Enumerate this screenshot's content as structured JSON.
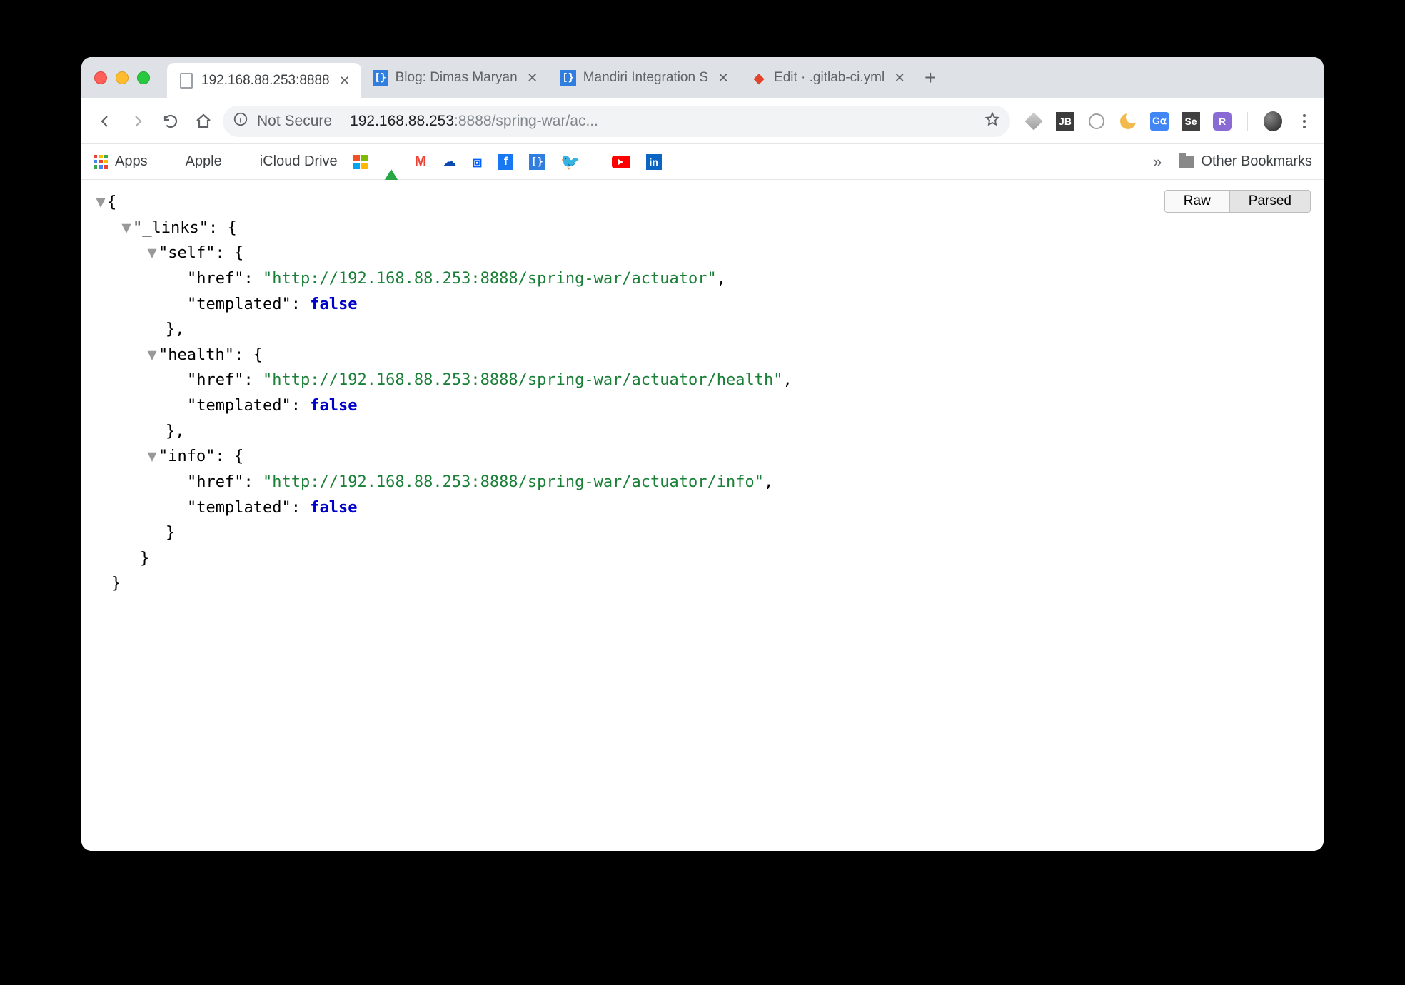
{
  "tabs": [
    {
      "title": "192.168.88.253:8888",
      "active": true,
      "icon": "file"
    },
    {
      "title": "Blog: Dimas Maryan",
      "active": false,
      "icon": "braces"
    },
    {
      "title": "Mandiri Integration S",
      "active": false,
      "icon": "braces"
    },
    {
      "title": "Edit · .gitlab-ci.yml",
      "active": false,
      "icon": "gitlab"
    }
  ],
  "address": {
    "security_label": "Not Secure",
    "host": "192.168.88.253",
    "port_path": ":8888/spring-war/ac..."
  },
  "bookmarks": {
    "apps": "Apps",
    "apple": "Apple",
    "icloud": "iCloud Drive",
    "other": "Other Bookmarks"
  },
  "json_buttons": {
    "raw": "Raw",
    "parsed": "Parsed"
  },
  "json": {
    "links_key": "_links",
    "self": {
      "key": "self",
      "href_key": "href",
      "href_val": "http://192.168.88.253:8888/spring-war/actuator",
      "templated_key": "templated",
      "templated_val": "false"
    },
    "health": {
      "key": "health",
      "href_key": "href",
      "href_val": "http://192.168.88.253:8888/spring-war/actuator/health",
      "templated_key": "templated",
      "templated_val": "false"
    },
    "info": {
      "key": "info",
      "href_key": "href",
      "href_val": "http://192.168.88.253:8888/spring-war/actuator/info",
      "templated_key": "templated",
      "templated_val": "false"
    }
  }
}
